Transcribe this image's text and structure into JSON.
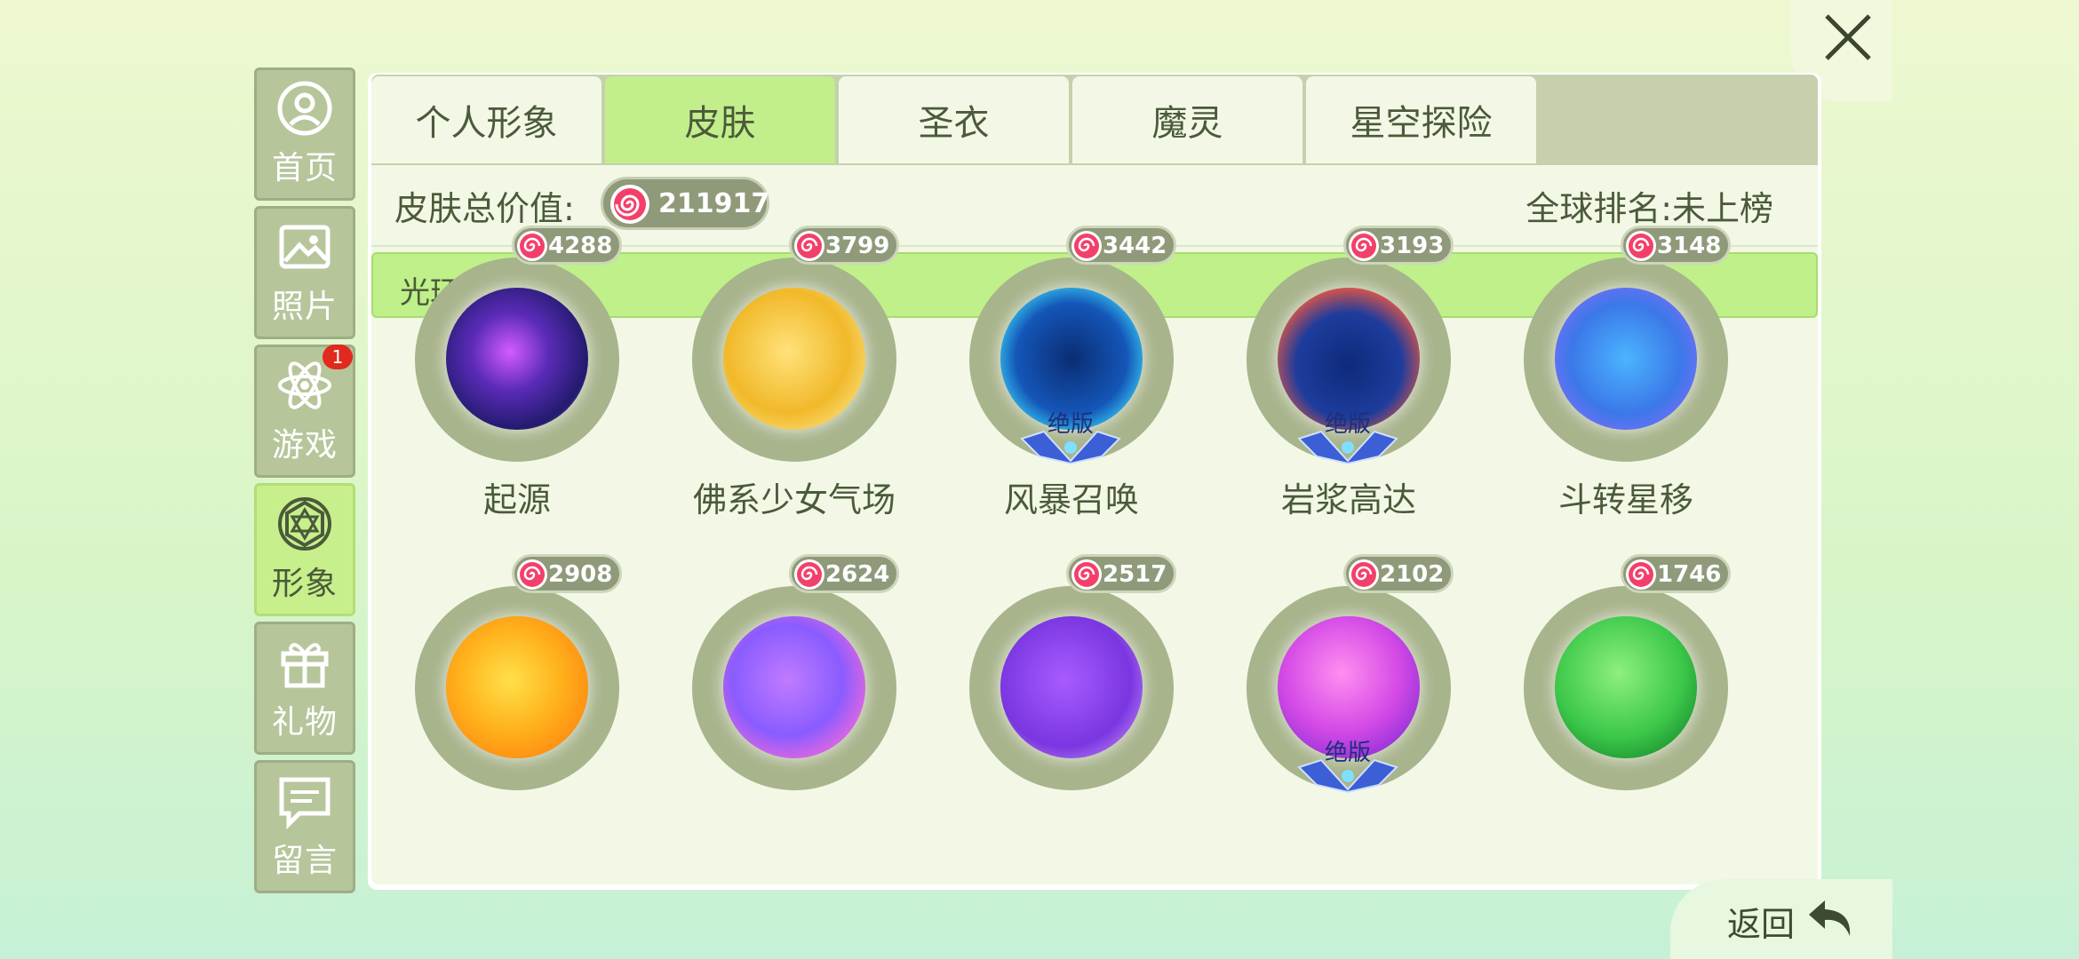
{
  "close": {
    "icon": "close-icon"
  },
  "sidebar": {
    "items": [
      {
        "label": "首页",
        "icon": "home-icon"
      },
      {
        "label": "照片",
        "icon": "photo-icon"
      },
      {
        "label": "游戏",
        "icon": "atom-icon",
        "badge": "1"
      },
      {
        "label": "形象",
        "icon": "diamond-icon",
        "active": true
      },
      {
        "label": "礼物",
        "icon": "gift-icon"
      },
      {
        "label": "留言",
        "icon": "message-icon"
      }
    ]
  },
  "tabs": [
    {
      "label": "个人形象"
    },
    {
      "label": "皮肤",
      "active": true
    },
    {
      "label": "圣衣"
    },
    {
      "label": "魔灵"
    },
    {
      "label": "星空探险"
    }
  ],
  "summary": {
    "value_label": "皮肤总价值:",
    "value": "211917",
    "rank": "全球排名:未上榜"
  },
  "section": {
    "label": "光环(70)"
  },
  "items": [
    {
      "name": "起源",
      "price": "4288",
      "limited": false
    },
    {
      "name": "佛系少女气场",
      "price": "3799",
      "limited": false
    },
    {
      "name": "风暴召唤",
      "price": "3442",
      "limited": true
    },
    {
      "name": "岩浆高达",
      "price": "3193",
      "limited": true
    },
    {
      "name": "斗转星移",
      "price": "3148",
      "limited": false
    },
    {
      "name": "",
      "price": "2908",
      "limited": false
    },
    {
      "name": "",
      "price": "2624",
      "limited": false
    },
    {
      "name": "",
      "price": "2517",
      "limited": false
    },
    {
      "name": "",
      "price": "2102",
      "limited": true
    },
    {
      "name": "",
      "price": "1746",
      "limited": false
    }
  ],
  "limited_label": "绝版",
  "footer": {
    "return_label": "返回"
  }
}
